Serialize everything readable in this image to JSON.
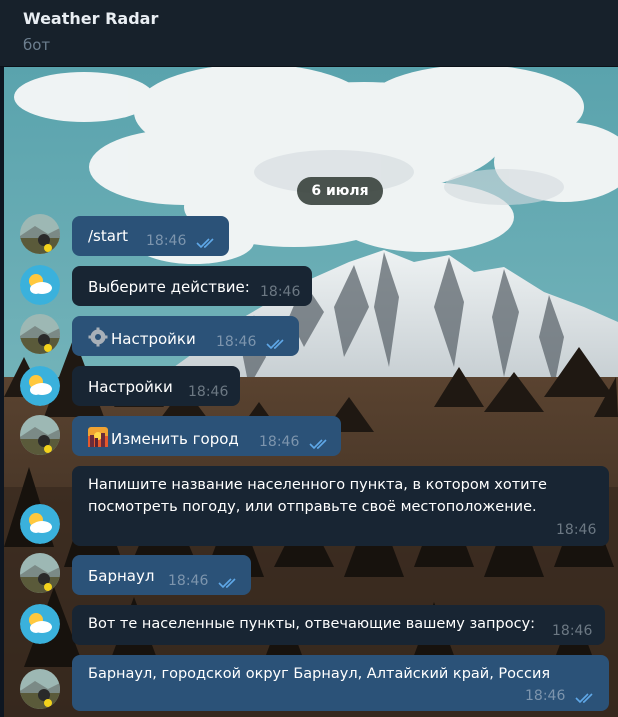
{
  "header": {
    "title": "Weather Radar",
    "subtitle": "бот"
  },
  "chat": {
    "date": "6 июля",
    "messages": [
      {
        "text": "/start",
        "time": "18:46"
      },
      {
        "text": "Выберите действие:",
        "time": "18:46"
      },
      {
        "icon": "gear-icon",
        "text": "Настройки",
        "time": "18:46"
      },
      {
        "text": "Настройки",
        "time": "18:46"
      },
      {
        "icon": "cityscape-icon",
        "text": "Изменить город",
        "time": "18:46"
      },
      {
        "text_lines": [
          "Напишите название населенного пункта, в котором хотите",
          "посмотреть погоду, или отправьте своё местоположение."
        ],
        "time": "18:46"
      },
      {
        "text": "Барнаул",
        "time": "18:46"
      },
      {
        "text": "Вот те населенные пункты, отвечающие вашему запросу:",
        "time": "18:46"
      },
      {
        "text": "Барнаул, городской округ Барнаул, Алтайский край, Россия",
        "time": "18:46"
      }
    ]
  },
  "colors": {
    "outgoing_bubble": "#2b5278",
    "incoming_bubble": "#182533",
    "header": "#17212b",
    "check": "#5fa8e8"
  }
}
